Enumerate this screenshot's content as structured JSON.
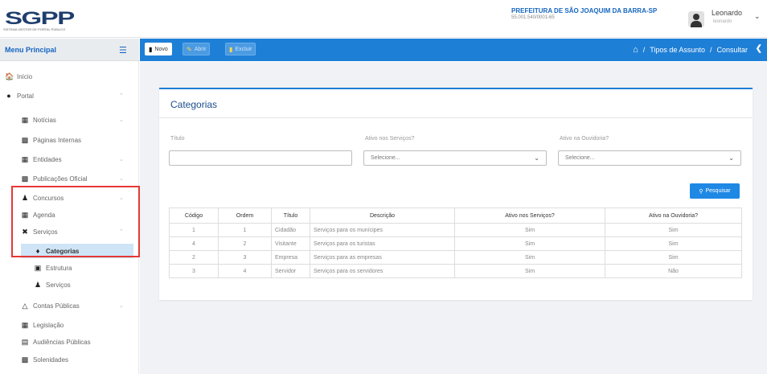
{
  "header": {
    "logo_text": "SGPP",
    "logo_sub": "SISTEMA GESTOR DE PORTAL PÚBLICO",
    "org_name": "PREFEITURA DE SÃO JOAQUIM DA BARRA-SP",
    "org_cnpj": "55.001.540/0001-65",
    "user_name": "Leonardo",
    "user_sub": "leonardo"
  },
  "sidebar": {
    "title": "Menu Principal",
    "items": [
      {
        "label": "Início",
        "icon": "home-icon"
      },
      {
        "label": "Portal",
        "icon": "globe-icon"
      },
      {
        "label": "Notícias",
        "icon": "newspaper-icon"
      },
      {
        "label": "Páginas Internas",
        "icon": "file-icon"
      },
      {
        "label": "Entidades",
        "icon": "building-icon"
      },
      {
        "label": "Publicações Oficial",
        "icon": "file-icon"
      },
      {
        "label": "Concursos",
        "icon": "users-icon"
      },
      {
        "label": "Agenda",
        "icon": "calendar-icon"
      },
      {
        "label": "Serviços",
        "icon": "tools-icon"
      },
      {
        "label": "Categorias",
        "icon": "tag-icon"
      },
      {
        "label": "Estrutura",
        "icon": "box-icon"
      },
      {
        "label": "Serviços",
        "icon": "people-icon"
      },
      {
        "label": "Contas Públicas",
        "icon": "bank-icon"
      },
      {
        "label": "Legislação",
        "icon": "book-icon"
      },
      {
        "label": "Audiências Públicas",
        "icon": "list-icon"
      },
      {
        "label": "Solenidades",
        "icon": "file-icon"
      }
    ]
  },
  "toolbar": {
    "novo": "Novo",
    "abrir": "Abrir",
    "excluir": "Excluir",
    "breadcrumb_1": "Tipos de Assunto",
    "breadcrumb_sep": "/",
    "breadcrumb_2": "Consultar"
  },
  "form": {
    "card_title": "Categorias",
    "titulo_label": "Título",
    "titulo_value": "",
    "ativo_servicos_label": "Ativo nos Serviços?",
    "ativo_servicos_value": "Selecione...",
    "ativo_ouvidoria_label": "Ativo na Ouvidoria?",
    "ativo_ouvidoria_value": "Selecione...",
    "search_button": "Pesquisar"
  },
  "table": {
    "headers": [
      "Código",
      "Ordem",
      "Título",
      "Descrição",
      "Ativo nos Serviços?",
      "Ativo na Ouvidoria?"
    ],
    "rows": [
      [
        "1",
        "1",
        "Cidadão",
        "Serviços para os munícipes",
        "Sim",
        "Sim"
      ],
      [
        "4",
        "2",
        "Visitante",
        "Serviços para os turistas",
        "Sim",
        "Sim"
      ],
      [
        "2",
        "3",
        "Empresa",
        "Serviços para as empresas",
        "Sim",
        "Sim"
      ],
      [
        "3",
        "4",
        "Servidor",
        "Serviços para os servidores",
        "Sim",
        "Não"
      ]
    ]
  }
}
